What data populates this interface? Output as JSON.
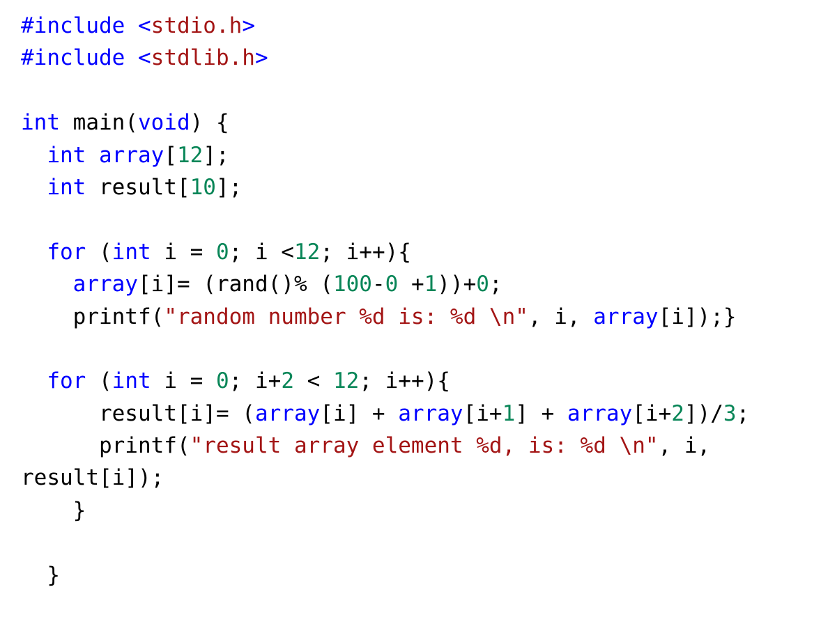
{
  "document": {
    "language": "c",
    "colors": {
      "keyword": "#0000ff",
      "string": "#a31515",
      "number": "#098658",
      "plain": "#000000",
      "background": "#ffffff"
    },
    "lines": [
      {
        "tokens": [
          {
            "t": "#include ",
            "c": "kw"
          },
          {
            "t": "<",
            "c": "kw"
          },
          {
            "t": "stdio.h",
            "c": "str"
          },
          {
            "t": ">",
            "c": "kw"
          }
        ]
      },
      {
        "tokens": [
          {
            "t": "#include ",
            "c": "kw"
          },
          {
            "t": "<",
            "c": "kw"
          },
          {
            "t": "stdlib.h",
            "c": "str"
          },
          {
            "t": ">",
            "c": "kw"
          }
        ]
      },
      {
        "tokens": []
      },
      {
        "tokens": [
          {
            "t": "int",
            "c": "kw"
          },
          {
            "t": " main(",
            "c": "plain"
          },
          {
            "t": "void",
            "c": "kw"
          },
          {
            "t": ") {",
            "c": "plain"
          }
        ]
      },
      {
        "tokens": [
          {
            "t": "  ",
            "c": "plain"
          },
          {
            "t": "int",
            "c": "kw"
          },
          {
            "t": " ",
            "c": "plain"
          },
          {
            "t": "array",
            "c": "kw"
          },
          {
            "t": "[",
            "c": "plain"
          },
          {
            "t": "12",
            "c": "num"
          },
          {
            "t": "];",
            "c": "plain"
          }
        ]
      },
      {
        "tokens": [
          {
            "t": "  ",
            "c": "plain"
          },
          {
            "t": "int",
            "c": "kw"
          },
          {
            "t": " result[",
            "c": "plain"
          },
          {
            "t": "10",
            "c": "num"
          },
          {
            "t": "];",
            "c": "plain"
          }
        ]
      },
      {
        "tokens": []
      },
      {
        "tokens": [
          {
            "t": "  ",
            "c": "plain"
          },
          {
            "t": "for",
            "c": "kw"
          },
          {
            "t": " (",
            "c": "plain"
          },
          {
            "t": "int",
            "c": "kw"
          },
          {
            "t": " i = ",
            "c": "plain"
          },
          {
            "t": "0",
            "c": "num"
          },
          {
            "t": "; i <",
            "c": "plain"
          },
          {
            "t": "12",
            "c": "num"
          },
          {
            "t": "; i++){",
            "c": "plain"
          }
        ]
      },
      {
        "tokens": [
          {
            "t": "    ",
            "c": "plain"
          },
          {
            "t": "array",
            "c": "kw"
          },
          {
            "t": "[i]= (rand()% (",
            "c": "plain"
          },
          {
            "t": "100",
            "c": "num"
          },
          {
            "t": "-",
            "c": "plain"
          },
          {
            "t": "0",
            "c": "num"
          },
          {
            "t": " +",
            "c": "plain"
          },
          {
            "t": "1",
            "c": "num"
          },
          {
            "t": "))+",
            "c": "plain"
          },
          {
            "t": "0",
            "c": "num"
          },
          {
            "t": ";",
            "c": "plain"
          }
        ]
      },
      {
        "tokens": [
          {
            "t": "    printf(",
            "c": "plain"
          },
          {
            "t": "\"random number %d is: %d \\n\"",
            "c": "str"
          },
          {
            "t": ", i, ",
            "c": "plain"
          },
          {
            "t": "array",
            "c": "kw"
          },
          {
            "t": "[i]);}",
            "c": "plain"
          }
        ]
      },
      {
        "tokens": []
      },
      {
        "tokens": [
          {
            "t": "  ",
            "c": "plain"
          },
          {
            "t": "for",
            "c": "kw"
          },
          {
            "t": " (",
            "c": "plain"
          },
          {
            "t": "int",
            "c": "kw"
          },
          {
            "t": " i = ",
            "c": "plain"
          },
          {
            "t": "0",
            "c": "num"
          },
          {
            "t": "; i+",
            "c": "plain"
          },
          {
            "t": "2",
            "c": "num"
          },
          {
            "t": " < ",
            "c": "plain"
          },
          {
            "t": "12",
            "c": "num"
          },
          {
            "t": "; i++){",
            "c": "plain"
          }
        ]
      },
      {
        "tokens": [
          {
            "t": "      result[i]= (",
            "c": "plain"
          },
          {
            "t": "array",
            "c": "kw"
          },
          {
            "t": "[i] + ",
            "c": "plain"
          },
          {
            "t": "array",
            "c": "kw"
          },
          {
            "t": "[i+",
            "c": "plain"
          },
          {
            "t": "1",
            "c": "num"
          },
          {
            "t": "] + ",
            "c": "plain"
          },
          {
            "t": "array",
            "c": "kw"
          },
          {
            "t": "[i+",
            "c": "plain"
          },
          {
            "t": "2",
            "c": "num"
          },
          {
            "t": "])/",
            "c": "plain"
          },
          {
            "t": "3",
            "c": "num"
          },
          {
            "t": ";",
            "c": "plain"
          }
        ]
      },
      {
        "tokens": [
          {
            "t": "      printf(",
            "c": "plain"
          },
          {
            "t": "\"result array element %d, is: %d \\n\"",
            "c": "str"
          },
          {
            "t": ", i,",
            "c": "plain"
          }
        ]
      },
      {
        "tokens": [
          {
            "t": "result[i]);",
            "c": "plain"
          }
        ]
      },
      {
        "tokens": [
          {
            "t": "    }",
            "c": "plain"
          }
        ]
      },
      {
        "tokens": []
      },
      {
        "tokens": [
          {
            "t": "  }",
            "c": "plain"
          }
        ]
      }
    ]
  }
}
